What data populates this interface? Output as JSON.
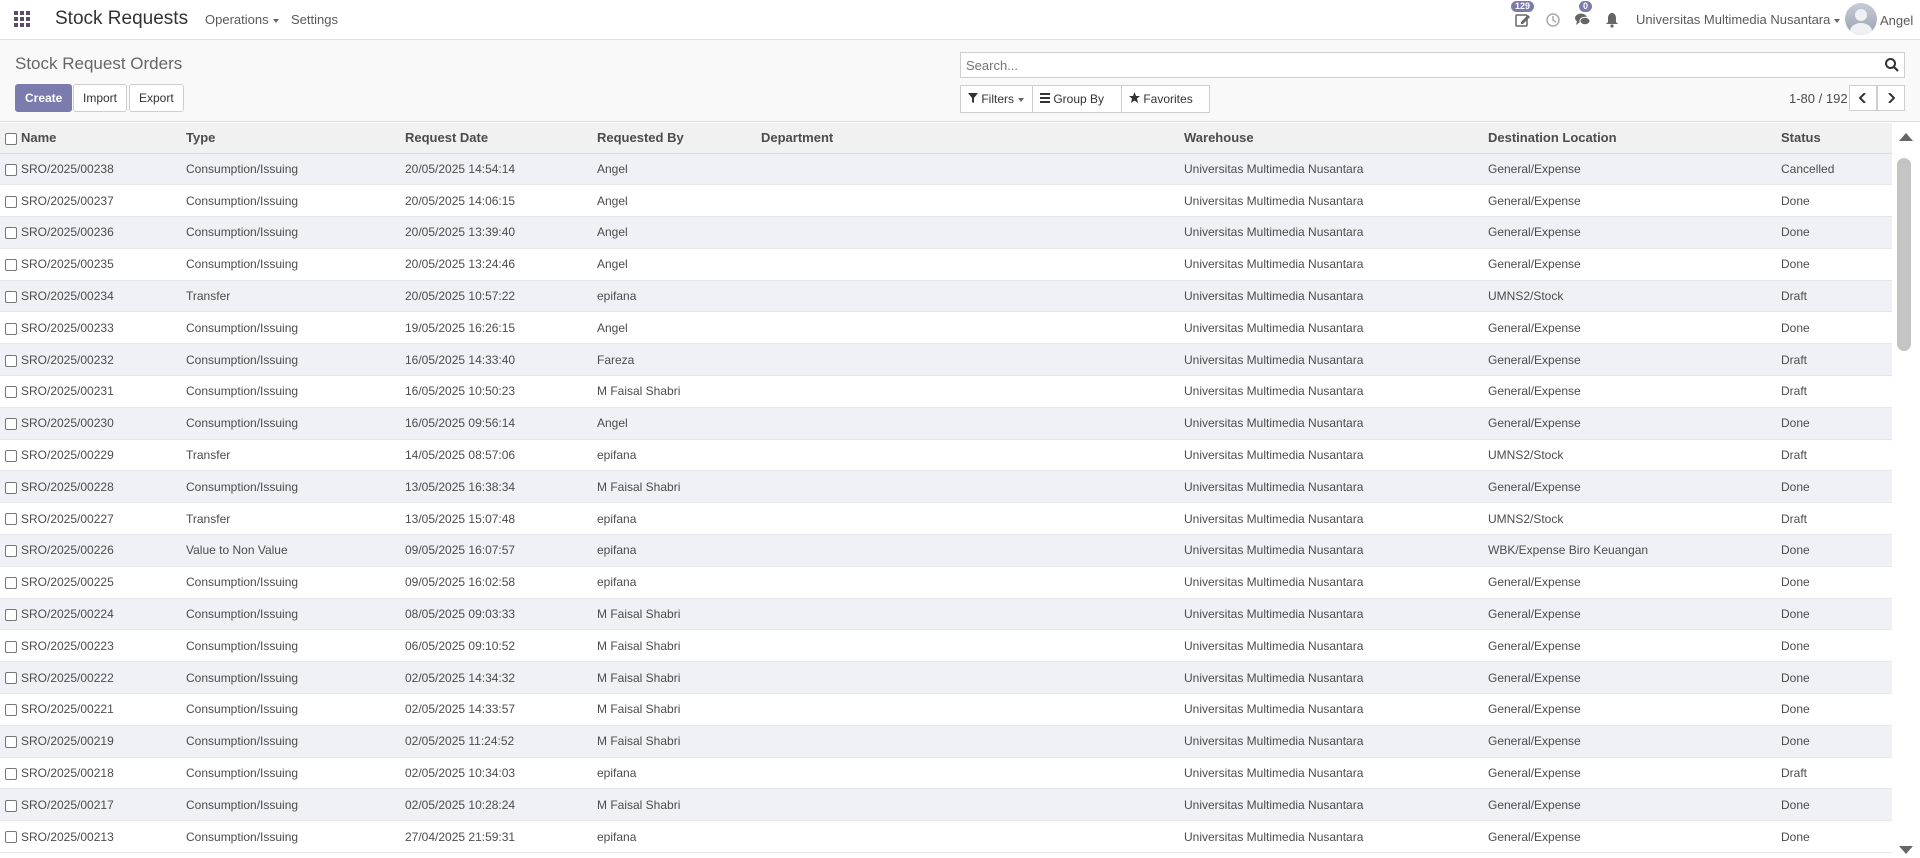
{
  "navbar": {
    "app_name": "Stock Requests",
    "menus": [
      "Operations",
      "Settings"
    ],
    "activity_badge": "129",
    "messages_badge": "0",
    "company": "Universitas Multimedia Nusantara",
    "user": "Angel",
    "icons": [
      "apps-grid-icon",
      "activity-edit-icon",
      "clock-icon",
      "chat-icon",
      "bell-icon"
    ]
  },
  "control_panel": {
    "title": "Stock Request Orders",
    "buttons": {
      "create": "Create",
      "import": "Import",
      "export": "Export"
    },
    "search_placeholder": "Search...",
    "filters": {
      "filters": "Filters",
      "group_by": "Group By",
      "favorites": "Favorites"
    },
    "pager": "1-80 / 192"
  },
  "colors": {
    "primary": "#7c7bad",
    "row_stripe": "#f0f0f7",
    "header_bg": "#f1f1f1"
  },
  "table": {
    "columns": [
      "Name",
      "Type",
      "Request Date",
      "Requested By",
      "Department",
      "Warehouse",
      "Destination Location",
      "Status"
    ],
    "rows": [
      [
        "SRO/2025/00238",
        "Consumption/Issuing",
        "20/05/2025 14:54:14",
        "Angel",
        "",
        "Universitas Multimedia Nusantara",
        "General/Expense",
        "Cancelled"
      ],
      [
        "SRO/2025/00237",
        "Consumption/Issuing",
        "20/05/2025 14:06:15",
        "Angel",
        "",
        "Universitas Multimedia Nusantara",
        "General/Expense",
        "Done"
      ],
      [
        "SRO/2025/00236",
        "Consumption/Issuing",
        "20/05/2025 13:39:40",
        "Angel",
        "",
        "Universitas Multimedia Nusantara",
        "General/Expense",
        "Done"
      ],
      [
        "SRO/2025/00235",
        "Consumption/Issuing",
        "20/05/2025 13:24:46",
        "Angel",
        "",
        "Universitas Multimedia Nusantara",
        "General/Expense",
        "Done"
      ],
      [
        "SRO/2025/00234",
        "Transfer",
        "20/05/2025 10:57:22",
        "epifana",
        "",
        "Universitas Multimedia Nusantara",
        "UMNS2/Stock",
        "Draft"
      ],
      [
        "SRO/2025/00233",
        "Consumption/Issuing",
        "19/05/2025 16:26:15",
        "Angel",
        "",
        "Universitas Multimedia Nusantara",
        "General/Expense",
        "Done"
      ],
      [
        "SRO/2025/00232",
        "Consumption/Issuing",
        "16/05/2025 14:33:40",
        "Fareza",
        "",
        "Universitas Multimedia Nusantara",
        "General/Expense",
        "Draft"
      ],
      [
        "SRO/2025/00231",
        "Consumption/Issuing",
        "16/05/2025 10:50:23",
        "M Faisal Shabri",
        "",
        "Universitas Multimedia Nusantara",
        "General/Expense",
        "Draft"
      ],
      [
        "SRO/2025/00230",
        "Consumption/Issuing",
        "16/05/2025 09:56:14",
        "Angel",
        "",
        "Universitas Multimedia Nusantara",
        "General/Expense",
        "Done"
      ],
      [
        "SRO/2025/00229",
        "Transfer",
        "14/05/2025 08:57:06",
        "epifana",
        "",
        "Universitas Multimedia Nusantara",
        "UMNS2/Stock",
        "Draft"
      ],
      [
        "SRO/2025/00228",
        "Consumption/Issuing",
        "13/05/2025 16:38:34",
        "M Faisal Shabri",
        "",
        "Universitas Multimedia Nusantara",
        "General/Expense",
        "Done"
      ],
      [
        "SRO/2025/00227",
        "Transfer",
        "13/05/2025 15:07:48",
        "epifana",
        "",
        "Universitas Multimedia Nusantara",
        "UMNS2/Stock",
        "Draft"
      ],
      [
        "SRO/2025/00226",
        "Value to Non Value",
        "09/05/2025 16:07:57",
        "epifana",
        "",
        "Universitas Multimedia Nusantara",
        "WBK/Expense Biro Keuangan",
        "Done"
      ],
      [
        "SRO/2025/00225",
        "Consumption/Issuing",
        "09/05/2025 16:02:58",
        "epifana",
        "",
        "Universitas Multimedia Nusantara",
        "General/Expense",
        "Done"
      ],
      [
        "SRO/2025/00224",
        "Consumption/Issuing",
        "08/05/2025 09:03:33",
        "M Faisal Shabri",
        "",
        "Universitas Multimedia Nusantara",
        "General/Expense",
        "Done"
      ],
      [
        "SRO/2025/00223",
        "Consumption/Issuing",
        "06/05/2025 09:10:52",
        "M Faisal Shabri",
        "",
        "Universitas Multimedia Nusantara",
        "General/Expense",
        "Done"
      ],
      [
        "SRO/2025/00222",
        "Consumption/Issuing",
        "02/05/2025 14:34:32",
        "M Faisal Shabri",
        "",
        "Universitas Multimedia Nusantara",
        "General/Expense",
        "Done"
      ],
      [
        "SRO/2025/00221",
        "Consumption/Issuing",
        "02/05/2025 14:33:57",
        "M Faisal Shabri",
        "",
        "Universitas Multimedia Nusantara",
        "General/Expense",
        "Done"
      ],
      [
        "SRO/2025/00219",
        "Consumption/Issuing",
        "02/05/2025 11:24:52",
        "M Faisal Shabri",
        "",
        "Universitas Multimedia Nusantara",
        "General/Expense",
        "Done"
      ],
      [
        "SRO/2025/00218",
        "Consumption/Issuing",
        "02/05/2025 10:34:03",
        "epifana",
        "",
        "Universitas Multimedia Nusantara",
        "General/Expense",
        "Draft"
      ],
      [
        "SRO/2025/00217",
        "Consumption/Issuing",
        "02/05/2025 10:28:24",
        "M Faisal Shabri",
        "",
        "Universitas Multimedia Nusantara",
        "General/Expense",
        "Done"
      ],
      [
        "SRO/2025/00213",
        "Consumption/Issuing",
        "27/04/2025 21:59:31",
        "epifana",
        "",
        "Universitas Multimedia Nusantara",
        "General/Expense",
        "Done"
      ]
    ]
  }
}
